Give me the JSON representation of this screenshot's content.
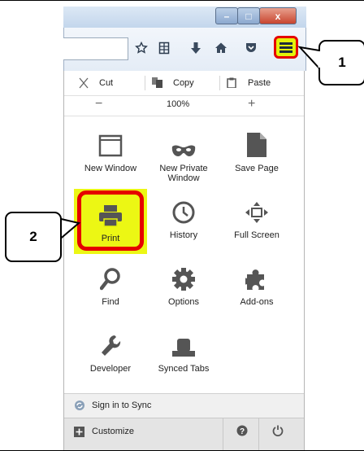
{
  "window": {
    "min_glyph": "–",
    "max_glyph": "□",
    "close_glyph": "x"
  },
  "toolbar": {
    "icons": [
      "bookmark-star-icon",
      "reading-list-icon",
      "download-icon",
      "home-icon",
      "pocket-icon",
      "hamburger-menu-icon"
    ]
  },
  "menu": {
    "edit": {
      "cut": "Cut",
      "copy": "Copy",
      "paste": "Paste"
    },
    "zoom": {
      "minus": "−",
      "value": "100%",
      "plus": "+"
    },
    "tiles": [
      {
        "label": "New Window",
        "icon": "window-icon"
      },
      {
        "label": "New Private Window",
        "icon": "private-mask-icon"
      },
      {
        "label": "Save Page",
        "icon": "page-icon"
      },
      {
        "label": "Print",
        "icon": "printer-icon"
      },
      {
        "label": "History",
        "icon": "clock-icon"
      },
      {
        "label": "Full Screen",
        "icon": "fullscreen-icon"
      },
      {
        "label": "Find",
        "icon": "magnifier-icon"
      },
      {
        "label": "Options",
        "icon": "gear-icon"
      },
      {
        "label": "Add-ons",
        "icon": "puzzle-icon"
      },
      {
        "label": "Developer",
        "icon": "wrench-icon"
      },
      {
        "label": "Synced Tabs",
        "icon": "synced-tabs-icon"
      }
    ],
    "sync": "Sign in to Sync",
    "customize": "Customize"
  },
  "callouts": {
    "one": "1",
    "two": "2"
  },
  "colors": {
    "highlight": "#e3f20a",
    "ring": "#e50000"
  }
}
